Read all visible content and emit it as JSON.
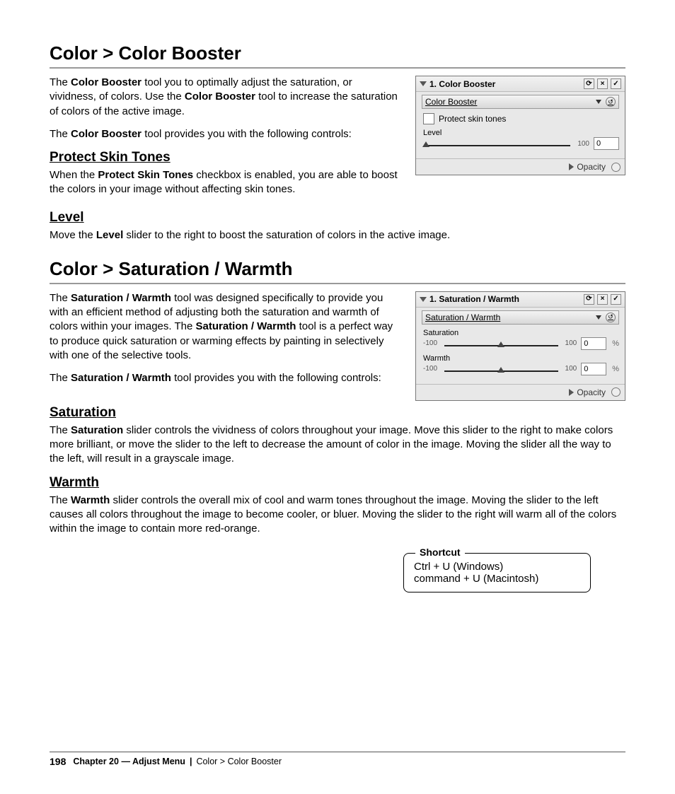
{
  "section1": {
    "heading": "Color > Color Booster",
    "p1_a": "The ",
    "p1_b": "Color Booster",
    "p1_c": " tool you to optimally adjust the saturation, or vividness, of colors. Use the ",
    "p1_d": "Color Booster",
    "p1_e": " tool to increase the saturation of colors of the active image.",
    "p2_a": "The ",
    "p2_b": "Color Booster",
    "p2_c": " tool provides you with the following controls:",
    "sub1": "Protect Skin Tones",
    "p3_a": "When the ",
    "p3_b": "Protect Skin Tones",
    "p3_c": " checkbox is enabled, you are able to boost the colors in your image without affecting skin tones.",
    "sub2": "Level",
    "p4_a": "Move the ",
    "p4_b": "Level",
    "p4_c": " slider to the right to boost the saturation of colors in the active image."
  },
  "panel1": {
    "title": "1. Color Booster",
    "dropdown": "Color Booster",
    "checkbox": "Protect skin tones",
    "slider_label": "Level",
    "slider_max": "100",
    "value": "0",
    "opacity": "Opacity"
  },
  "section2": {
    "heading": "Color > Saturation / Warmth",
    "p1_a": "The ",
    "p1_b": "Saturation / Warmth",
    "p1_c": " tool was designed specifically to provide you with an efficient method of adjusting both the saturation and warmth of colors within your images. The ",
    "p1_d": "Saturation / Warmth",
    "p1_e": " tool is a perfect way to produce quick saturation or warming effects by painting in selectively with one of the selective tools.",
    "p2_a": "The ",
    "p2_b": "Saturation / Warmth",
    "p2_c": " tool provides you with the following controls:",
    "sub1": "Saturation",
    "p3_a": "The ",
    "p3_b": "Saturation",
    "p3_c": " slider controls the vividness of colors throughout your image. Move this slider to the right to make colors more brilliant, or move the slider to the left to decrease the amount of color in the image. Moving the slider all the way to the left, will result in a grayscale image.",
    "sub2": "Warmth",
    "p4_a": "The ",
    "p4_b": "Warmth",
    "p4_c": " slider controls the overall mix of cool and warm tones throughout the image. Moving the slider to the left causes all colors throughout the image to become cooler, or bluer. Moving the slider to the right will warm all of the colors within the image to contain more red-orange."
  },
  "panel2": {
    "title": "1. Saturation / Warmth",
    "dropdown": "Saturation / Warmth",
    "sat_label": "Saturation",
    "warm_label": "Warmth",
    "min": "-100",
    "max": "100",
    "value": "0",
    "pct": "%",
    "opacity": "Opacity"
  },
  "shortcut": {
    "legend": "Shortcut",
    "line1": "Ctrl + U (Windows)",
    "line2": "command + U (Macintosh)"
  },
  "footer": {
    "page": "198",
    "chapter": "Chapter 20 — Adjust Menu",
    "crumb": "Color > Color Booster"
  }
}
